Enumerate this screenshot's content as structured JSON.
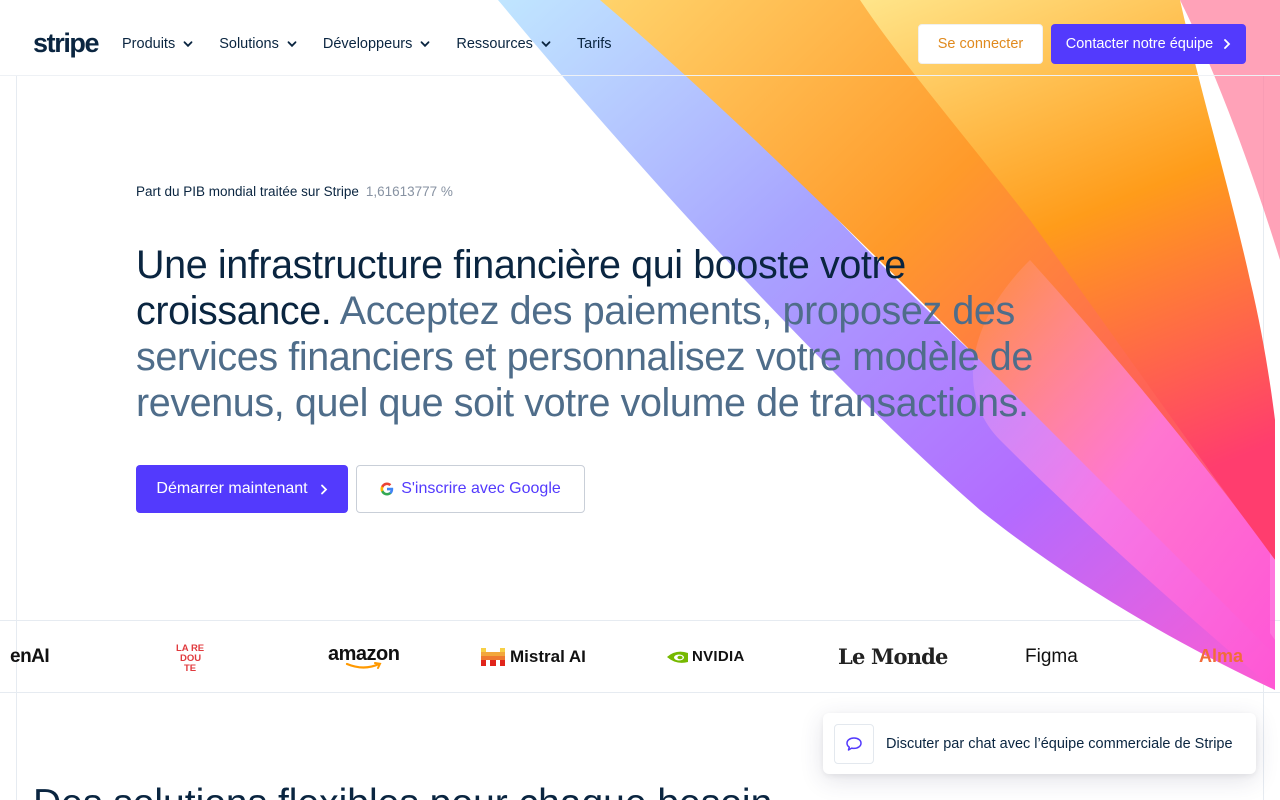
{
  "nav": {
    "logo": "stripe",
    "items": [
      {
        "label": "Produits",
        "has_chevron": true
      },
      {
        "label": "Solutions",
        "has_chevron": true
      },
      {
        "label": "Développeurs",
        "has_chevron": true
      },
      {
        "label": "Ressources",
        "has_chevron": true
      },
      {
        "label": "Tarifs",
        "has_chevron": false
      }
    ],
    "login_label": "Se connecter",
    "contact_label": "Contacter notre équipe",
    "accent_color": "#533afd",
    "login_color": "#e08a1e"
  },
  "hero": {
    "stat_label": "Part du PIB mondial traitée sur Stripe",
    "stat_value": "1,61613777 %",
    "headline_strong": "Une infrastructure financière qui booste votre croissance.",
    "headline_soft": "Acceptez des paiements, proposez des services financiers et personnalisez votre modèle de revenus, quel que soit votre volume de transactions.",
    "cta_primary": "Démarrer maintenant",
    "cta_google": "S'inscrire avec Google"
  },
  "logos": {
    "openai": "enAI",
    "redoute_lines": [
      "LA RE",
      "DOU",
      "TE"
    ],
    "amazon": "amazon",
    "mistral": "Mistral AI",
    "nvidia": "NVIDIA",
    "lemonde": "Le Monde",
    "figma": "Figma",
    "alma": "Alma"
  },
  "chat": {
    "label": "Discuter par chat avec l’équipe commerciale de Stripe",
    "icon": "chat-bubble-icon"
  },
  "next_section": {
    "heading": "Des solutions flexibles pour chaque besoin"
  }
}
